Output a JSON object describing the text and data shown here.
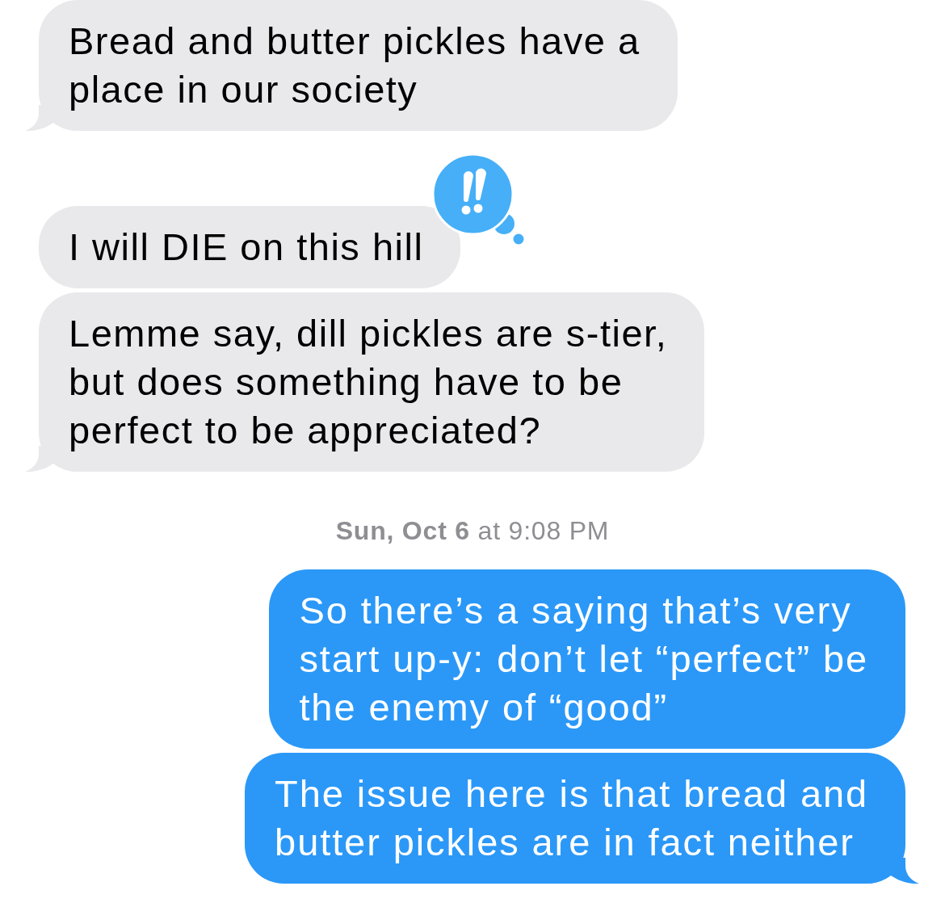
{
  "conversation": {
    "items": [
      {
        "kind": "incoming",
        "tail": true,
        "text": "Bread and butter pickles have a\nplace in our society"
      },
      {
        "kind": "incoming",
        "tail": false,
        "tapback": {
          "kind": "exclamation"
        },
        "text": "I will DIE on this hill"
      },
      {
        "kind": "incoming",
        "tail": true,
        "text": "Lemme say, dill pickles are s-tier,\nbut does something have to be\nperfect to be appreciated?"
      },
      {
        "kind": "timestamp",
        "text": "**Sun, Oct 6** at 9:08 PM"
      },
      {
        "kind": "outgoing",
        "tail": false,
        "text": "So there’s a saying that’s very\nstart up-y: don’t let “perfect” be\nthe enemy of “good”"
      },
      {
        "kind": "outgoing",
        "tail": true,
        "text": "The issue here is that bread and\nbutter pickles are in fact neither"
      }
    ]
  }
}
